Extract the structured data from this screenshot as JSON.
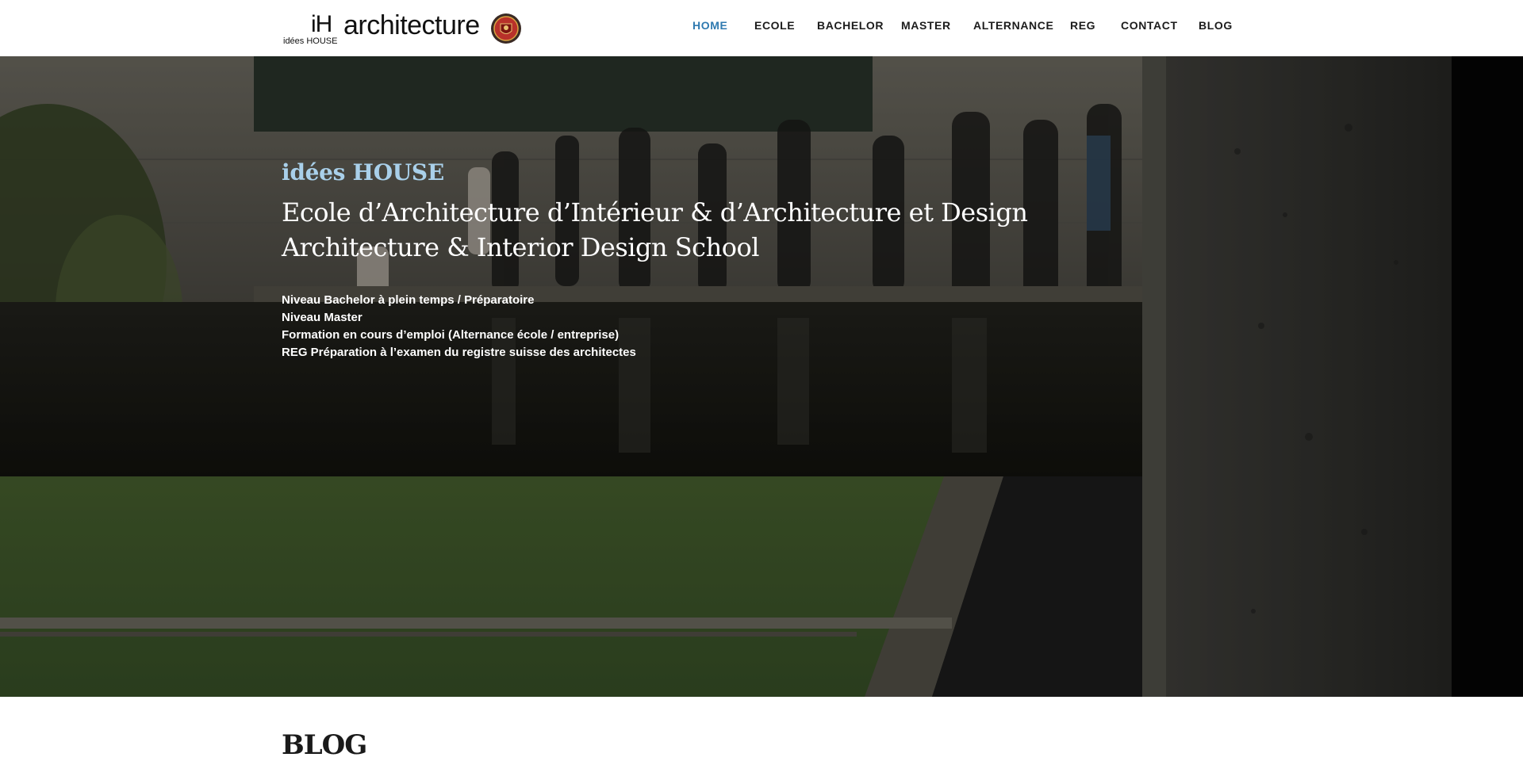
{
  "header": {
    "logo": {
      "mark": "iH",
      "subtitle": "idées HOUSE",
      "word": "architecture",
      "seal_icon": "seal-emblem-icon"
    },
    "nav": [
      {
        "label": "HOME",
        "active": true
      },
      {
        "label": "ECOLE",
        "active": false
      },
      {
        "label": "BACHELOR",
        "active": false
      },
      {
        "label": "MASTER",
        "active": false
      },
      {
        "label": "ALTERNANCE",
        "active": false
      },
      {
        "label": "REG",
        "active": false
      },
      {
        "label": "CONTACT",
        "active": false
      },
      {
        "label": "BLOG",
        "active": false
      }
    ]
  },
  "hero": {
    "kicker": "idées HOUSE",
    "title_line_1": "Ecole d’Architecture d’Intérieur & d’Architecture et Design",
    "title_line_2": "Architecture & Interior Design School",
    "programs": [
      "Niveau Bachelor à plein temps / Préparatoire",
      "Niveau Master",
      "Formation en cours d’emploi (Alternance école / entreprise)",
      "REG Préparation à l’examen du registre suisse des architectes"
    ]
  },
  "blog": {
    "title": "BLOG"
  },
  "colors": {
    "nav_active": "#2f7ab0",
    "nav_text": "#1c1c1c",
    "hero_kicker": "#a9d0ea",
    "hero_text": "#ffffff"
  }
}
